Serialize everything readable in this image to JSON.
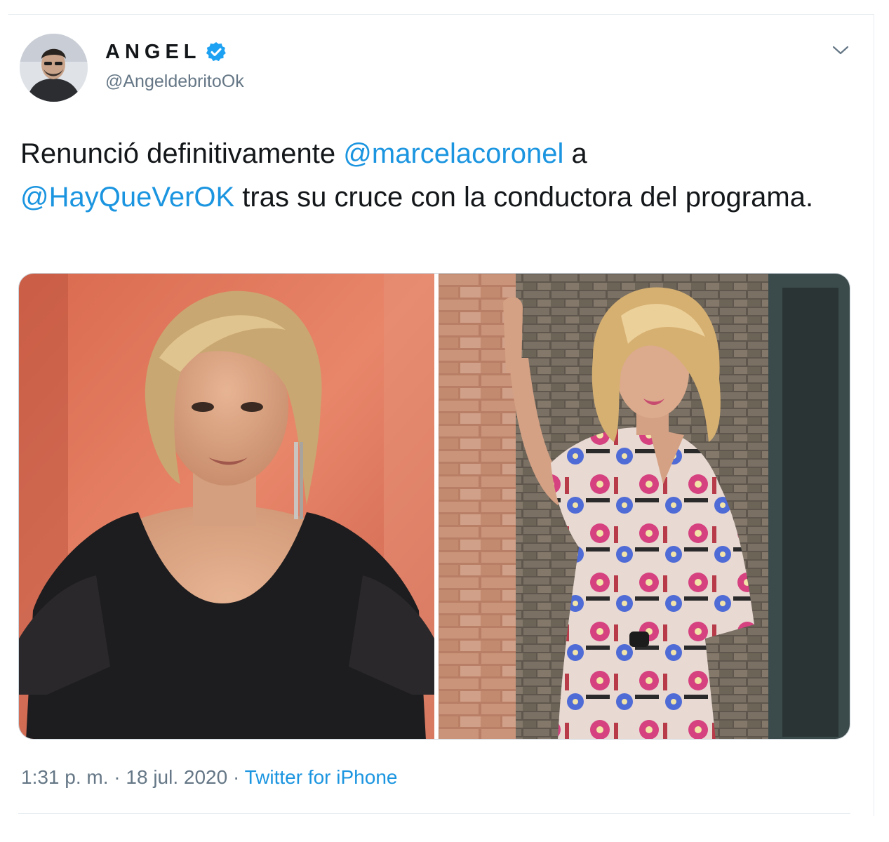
{
  "author": {
    "display_name": "ANGEL",
    "handle": "@AngeldebritoOk",
    "verified": true,
    "avatar_icon": "profile-photo"
  },
  "tweet": {
    "text_parts": {
      "p1": "Renunció definitivamente ",
      "mention1": "@marcelacoronel",
      "p2": " a ",
      "mention2": "@HayQueVerOK",
      "p3": " tras su cruce con la conductora del programa."
    },
    "media": [
      {
        "icon": "photo-woman-black-dress"
      },
      {
        "icon": "photo-woman-floral-dress-brick-wall"
      }
    ]
  },
  "meta": {
    "time": "1:31 p. m.",
    "separator1": " · ",
    "date": "18 jul. 2020",
    "separator2": " · ",
    "source": "Twitter for iPhone"
  },
  "colors": {
    "link": "#1b95e0",
    "text": "#14171a",
    "secondary": "#657786",
    "verified": "#1da1f2"
  }
}
